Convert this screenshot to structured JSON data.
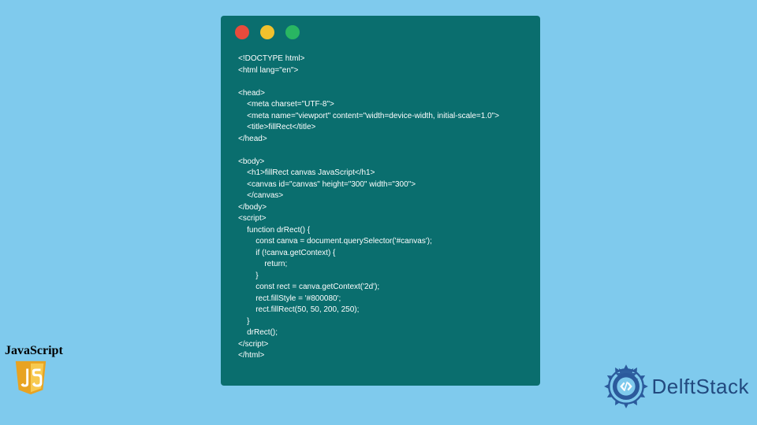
{
  "code_window": {
    "dots": [
      "red",
      "yellow",
      "green"
    ],
    "code": "<!DOCTYPE html>\n<html lang=\"en\">\n\n<head>\n    <meta charset=\"UTF-8\">\n    <meta name=\"viewport\" content=\"width=device-width, initial-scale=1.0\">\n    <title>fillRect</title>\n</head>\n\n<body>\n    <h1>fillRect canvas JavaScript</h1>\n    <canvas id=\"canvas\" height=\"300\" width=\"300\">\n    </canvas>\n</body>\n<script>\n    function drRect() {\n        const canva = document.querySelector('#canvas');\n        if (!canva.getContext) {\n            return;\n        }\n        const rect = canva.getContext('2d');\n        rect.fillStyle = '#800080';\n        rect.fillRect(50, 50, 200, 250);\n    }\n    drRect();\n</script>\n</html>"
  },
  "js_badge": {
    "label": "JavaScript",
    "logo_bg": "#f7df1e",
    "logo_text": "JS"
  },
  "delftstack": {
    "text": "DelftStack",
    "icon_color": "#2b5a9c"
  }
}
